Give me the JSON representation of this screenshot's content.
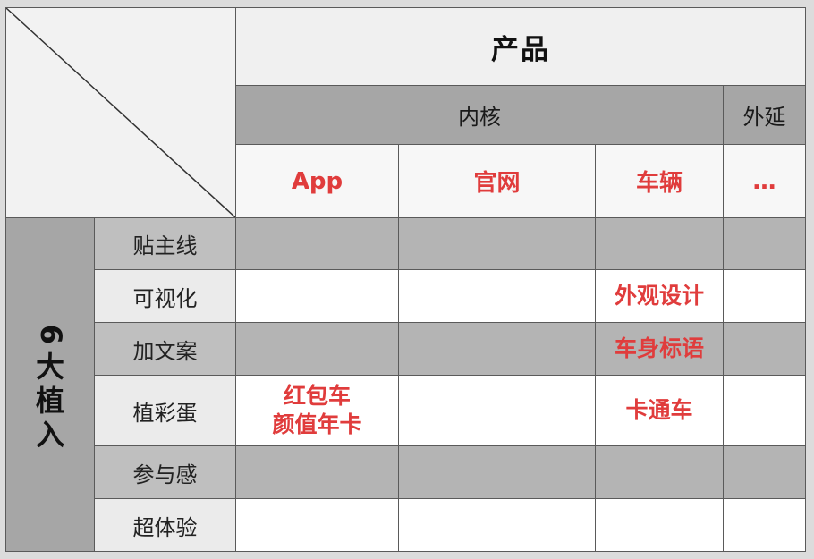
{
  "table": {
    "product_header": "产品",
    "group_core": "内核",
    "group_extension": "外延",
    "columns": [
      "App",
      "官网",
      "车辆",
      "…"
    ],
    "side_label": {
      "number": "6",
      "chars": [
        "大",
        "植",
        "入"
      ]
    },
    "rows": [
      {
        "label": "贴主线",
        "cells": [
          "",
          "",
          "",
          ""
        ]
      },
      {
        "label": "可视化",
        "cells": [
          "",
          "",
          "外观设计",
          ""
        ]
      },
      {
        "label": "加文案",
        "cells": [
          "",
          "",
          "车身标语",
          ""
        ]
      },
      {
        "label": "植彩蛋",
        "cells": [
          "红包车\n颜值年卡",
          "",
          "卡通车",
          ""
        ]
      },
      {
        "label": "参与感",
        "cells": [
          "",
          "",
          "",
          ""
        ]
      },
      {
        "label": "超体验",
        "cells": [
          "",
          "",
          "",
          ""
        ]
      }
    ]
  },
  "colors": {
    "accent_red": "#e03c3c",
    "header_gray": "#a6a6a6",
    "row_shade": "#b4b4b4",
    "border": "#5a5a5a"
  }
}
